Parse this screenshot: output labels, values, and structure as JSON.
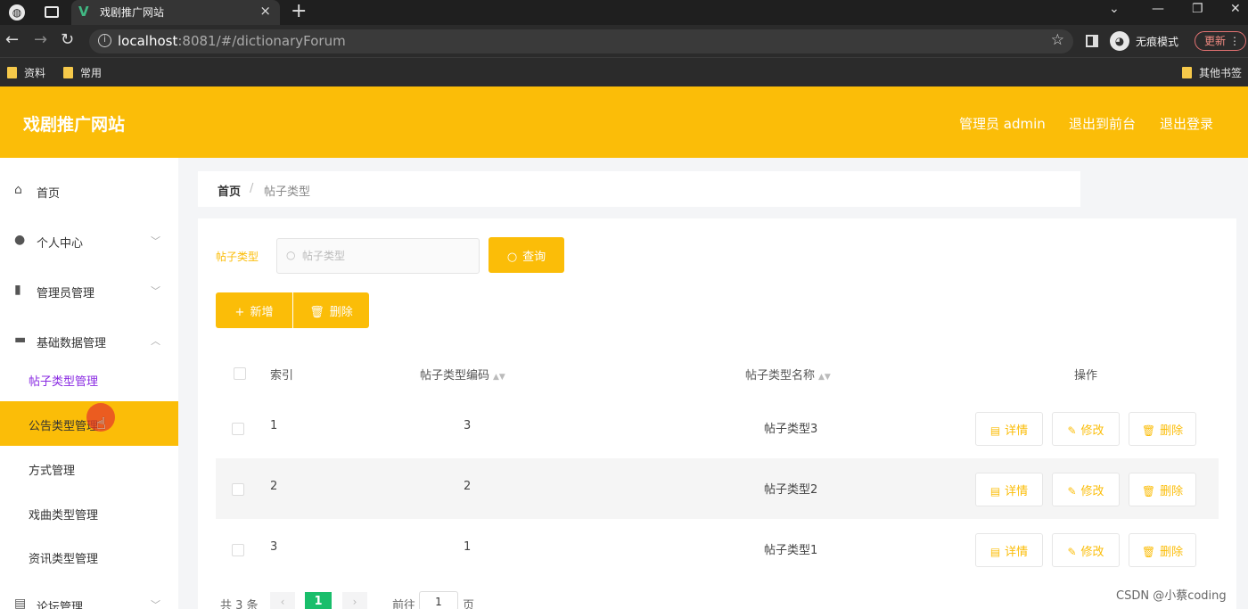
{
  "browser": {
    "tab_title": "戏剧推广网站",
    "url_host": "localhost",
    "url_rest": ":8081/#/dictionaryForum",
    "incognito_label": "无痕模式",
    "update_label": "更新",
    "bookmarks": [
      "资料",
      "常用"
    ],
    "other_bookmarks": "其他书签"
  },
  "header": {
    "logo": "戏剧推广网站",
    "user": "管理员 admin",
    "to_front": "退出到前台",
    "logout": "退出登录"
  },
  "sidebar": {
    "items": [
      {
        "label": "首页",
        "icon": "home-icon"
      },
      {
        "label": "个人中心",
        "icon": "user-icon"
      },
      {
        "label": "管理员管理",
        "icon": "bar-chart-icon"
      },
      {
        "label": "基础数据管理",
        "icon": "monitor-icon"
      }
    ],
    "subitems": [
      "帖子类型管理",
      "公告类型管理",
      "方式管理",
      "戏曲类型管理",
      "资讯类型管理"
    ],
    "last_item": "论坛管理"
  },
  "breadcrumb": {
    "home": "首页",
    "sep": "/",
    "current": "帖子类型"
  },
  "filter": {
    "label": "帖子类型",
    "placeholder": "帖子类型",
    "search_button": "查询"
  },
  "toolbar": {
    "add": "新增",
    "delete": "删除"
  },
  "table": {
    "headers": {
      "index": "索引",
      "code": "帖子类型编码",
      "name": "帖子类型名称",
      "ops": "操作"
    },
    "rows": [
      {
        "index": "1",
        "code": "3",
        "name": "帖子类型3"
      },
      {
        "index": "2",
        "code": "2",
        "name": "帖子类型2"
      },
      {
        "index": "3",
        "code": "1",
        "name": "帖子类型1"
      }
    ],
    "actions": {
      "detail": "详情",
      "edit": "修改",
      "delete": "删除"
    }
  },
  "pager": {
    "total": "共 3 条",
    "current": "1",
    "goto": "前往",
    "page_value": "1",
    "page_unit": "页"
  },
  "watermark": "CSDN @小蔡coding",
  "colors": {
    "accent": "#fbbd08",
    "pager_active": "#19be6b",
    "active_sub": "#8a2be2"
  }
}
